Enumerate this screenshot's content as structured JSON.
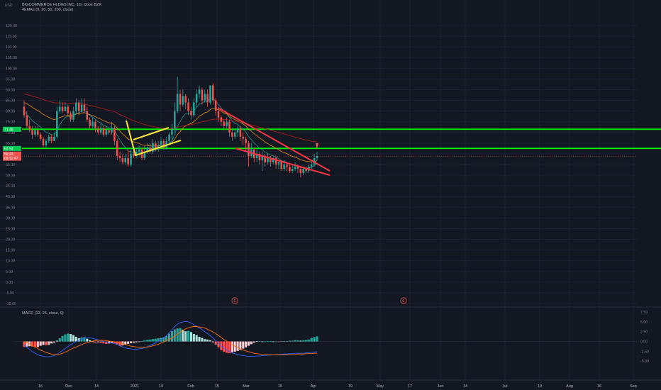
{
  "main": {
    "symbol_line": "BIGCOMMERCE HLDGS INC, 1D, Cboe BZX",
    "indicator_label": "4EMAs (9, 20, 50, 200, close)",
    "currency_label": "USD",
    "y_ticks": [
      "120.00",
      "115.00",
      "110.00",
      "105.00",
      "100.00",
      "95.00",
      "90.00",
      "85.00",
      "80.00",
      "75.00",
      "70.00",
      "65.00",
      "60.00",
      "55.00",
      "50.00",
      "45.00",
      "40.00",
      "35.00",
      "30.00",
      "25.00",
      "20.00",
      "15.00",
      "10.00",
      "5.00",
      "0.00",
      "-5.00",
      "-10.00"
    ],
    "price_badges": [
      {
        "text": "71.48",
        "color": "#00c853"
      },
      {
        "text": "62.53",
        "color": "#00c853"
      },
      {
        "text": "58.93",
        "color": "#ef5350"
      },
      {
        "text": "09:12:47",
        "color": "#ef5350"
      }
    ],
    "earnings_marker": "E"
  },
  "macd": {
    "label": "MACD (12, 26, close, 9)",
    "y_ticks": [
      "7.50",
      "5.00",
      "2.50",
      "0.00",
      "-2.50",
      "-5.00"
    ]
  },
  "time_axis": {
    "labels": [
      "16",
      "Dec",
      "14",
      "2021",
      "14",
      "Feb",
      "15",
      "Mar",
      "15",
      "Apr",
      "19",
      "May",
      "17",
      "Jun",
      "14",
      "Jul",
      "19",
      "Aug",
      "16",
      "Sep"
    ]
  },
  "colors": {
    "background": "#131722",
    "up": "#26a69a",
    "down": "#ef5350",
    "hline": "#00e600",
    "flag": "#ffeb3b",
    "wedge": "#f23645",
    "macd_line": "#2962ff",
    "signal_line": "#ff6d00"
  },
  "chart_data": {
    "type": "candlestick",
    "title": "BIGCOMMERCE HLDGS INC, 1D, Cboe BZX",
    "ylim": [
      -10,
      120
    ],
    "horizontal_levels": [
      71.48,
      62.53
    ],
    "candles": [
      [
        82,
        78,
        85,
        77
      ],
      [
        78,
        73,
        80,
        72
      ],
      [
        73,
        71,
        76,
        70
      ],
      [
        71,
        69,
        73,
        67
      ],
      [
        69,
        71,
        73,
        68
      ],
      [
        71,
        69,
        73,
        68
      ],
      [
        69,
        67,
        70,
        66
      ],
      [
        67,
        64,
        68,
        63
      ],
      [
        64,
        66,
        67,
        63
      ],
      [
        66,
        68,
        69,
        65
      ],
      [
        68,
        66,
        69,
        65
      ],
      [
        66,
        68,
        70,
        66
      ],
      [
        68,
        80,
        82,
        67
      ],
      [
        80,
        82,
        85,
        79
      ],
      [
        82,
        80,
        84,
        79
      ],
      [
        80,
        82,
        84,
        80
      ],
      [
        82,
        79,
        83,
        78
      ],
      [
        79,
        76,
        80,
        75
      ],
      [
        76,
        80,
        82,
        75
      ],
      [
        80,
        84,
        86,
        79
      ],
      [
        84,
        80,
        85,
        78
      ],
      [
        80,
        83,
        86,
        79
      ],
      [
        83,
        80,
        86,
        79
      ],
      [
        80,
        76,
        82,
        75
      ],
      [
        76,
        73,
        77,
        72
      ],
      [
        73,
        75,
        77,
        72
      ],
      [
        75,
        72,
        76,
        70
      ],
      [
        72,
        70,
        73,
        69
      ],
      [
        70,
        72,
        74,
        69
      ],
      [
        72,
        69,
        73,
        68
      ],
      [
        69,
        71,
        73,
        68
      ],
      [
        71,
        70,
        72,
        69
      ],
      [
        70,
        72,
        75,
        69
      ],
      [
        72,
        66,
        73,
        64
      ],
      [
        66,
        59,
        67,
        57
      ],
      [
        59,
        58,
        61,
        56
      ],
      [
        58,
        56,
        60,
        55
      ],
      [
        56,
        58,
        60,
        55
      ],
      [
        58,
        55,
        62,
        54
      ],
      [
        55,
        60,
        62,
        54
      ],
      [
        60,
        59,
        62,
        58
      ],
      [
        59,
        61,
        63,
        58
      ],
      [
        61,
        62,
        64,
        60
      ],
      [
        62,
        58,
        63,
        57
      ],
      [
        58,
        61,
        64,
        57
      ],
      [
        61,
        63,
        65,
        60
      ],
      [
        63,
        61,
        65,
        60
      ],
      [
        61,
        65,
        67,
        60
      ],
      [
        65,
        62,
        66,
        61
      ],
      [
        62,
        64,
        66,
        61
      ],
      [
        64,
        66,
        68,
        63
      ],
      [
        66,
        63,
        67,
        62
      ],
      [
        63,
        66,
        68,
        62
      ],
      [
        66,
        69,
        70,
        65
      ],
      [
        69,
        72,
        74,
        67
      ],
      [
        72,
        80,
        84,
        70
      ],
      [
        80,
        88,
        96,
        79
      ],
      [
        88,
        83,
        90,
        80
      ],
      [
        83,
        87,
        90,
        82
      ],
      [
        87,
        84,
        88,
        81
      ],
      [
        84,
        80,
        86,
        78
      ],
      [
        80,
        78,
        82,
        76
      ],
      [
        78,
        84,
        86,
        77
      ],
      [
        84,
        88,
        90,
        82
      ],
      [
        88,
        90,
        92,
        86
      ],
      [
        90,
        85,
        91,
        83
      ],
      [
        85,
        88,
        90,
        84
      ],
      [
        88,
        84,
        90,
        82
      ],
      [
        84,
        92,
        92,
        83
      ],
      [
        92,
        85,
        93,
        83
      ],
      [
        85,
        80,
        86,
        78
      ],
      [
        80,
        77,
        82,
        75
      ],
      [
        77,
        75,
        78,
        73
      ],
      [
        75,
        73,
        76,
        71
      ],
      [
        73,
        75,
        77,
        72
      ],
      [
        75,
        70,
        76,
        68
      ],
      [
        70,
        68,
        72,
        66
      ],
      [
        68,
        70,
        72,
        67
      ],
      [
        70,
        72,
        73,
        68
      ],
      [
        72,
        68,
        73,
        66
      ],
      [
        68,
        67,
        70,
        64
      ],
      [
        67,
        65,
        68,
        61
      ],
      [
        65,
        59,
        66,
        54
      ],
      [
        59,
        62,
        65,
        58
      ],
      [
        62,
        58,
        63,
        56
      ],
      [
        58,
        60,
        62,
        56
      ],
      [
        60,
        57,
        61,
        55
      ],
      [
        57,
        59,
        61,
        52
      ],
      [
        59,
        56,
        60,
        54
      ],
      [
        56,
        58,
        60,
        55
      ],
      [
        58,
        56,
        59,
        54
      ],
      [
        56,
        58,
        59,
        55
      ],
      [
        58,
        55,
        59,
        53
      ],
      [
        55,
        56,
        57,
        53
      ],
      [
        56,
        53,
        57,
        52
      ],
      [
        53,
        55,
        57,
        52
      ],
      [
        55,
        54,
        56,
        52
      ],
      [
        54,
        52,
        55,
        51
      ],
      [
        52,
        53,
        55,
        51
      ],
      [
        53,
        54,
        56,
        52
      ],
      [
        54,
        53,
        55,
        51
      ],
      [
        53,
        51,
        54,
        49
      ],
      [
        51,
        53,
        54,
        50
      ],
      [
        53,
        52,
        54,
        51
      ],
      [
        52,
        54,
        55,
        51
      ],
      [
        54,
        55,
        56,
        53
      ],
      [
        55,
        58,
        60,
        54
      ],
      [
        58,
        59,
        61,
        57
      ]
    ],
    "macd_hist": [
      -1.4,
      -1.3,
      -1.2,
      -1.3,
      -1.5,
      -1.4,
      -1.1,
      -0.9,
      -1.0,
      -0.8,
      -0.5,
      -0.3,
      0.2,
      0.8,
      1.4,
      1.8,
      2.0,
      1.9,
      1.6,
      1.2,
      0.8,
      1.0,
      1.1,
      0.7,
      0.3,
      -0.1,
      -0.3,
      -0.2,
      -0.4,
      -0.5,
      -0.6,
      -0.5,
      -0.4,
      -0.5,
      -0.8,
      -1.2,
      -1.0,
      -0.8,
      -0.6,
      -0.4,
      -0.3,
      -0.2,
      -0.1,
      0.1,
      0.3,
      0.4,
      0.5,
      0.6,
      0.7,
      0.8,
      0.9,
      1.1,
      1.4,
      2.0,
      2.6,
      3.1,
      3.3,
      3.4,
      3.0,
      2.6,
      2.7,
      2.4,
      1.9,
      1.6,
      1.2,
      0.9,
      0.6,
      0.5,
      0.3,
      -0.2,
      -0.8,
      -1.5,
      -2.2,
      -2.6,
      -2.9,
      -3.0,
      -2.8,
      -2.6,
      -2.4,
      -2.2,
      -1.8,
      -1.5,
      -1.1,
      -0.7,
      -0.3,
      0.1,
      0.1,
      0.0,
      0.0,
      0.1,
      0.1,
      0.0,
      0.0,
      -0.1,
      0.1,
      0.1,
      0.1,
      0.2,
      0.2,
      0.3,
      0.3,
      0.2,
      0.3,
      0.4,
      0.5,
      0.9,
      1.1,
      1.3
    ],
    "macd_line": [
      -1.0,
      -1.5,
      -2.0,
      -2.6,
      -3.0,
      -3.4,
      -3.6,
      -3.8,
      -3.9,
      -3.9,
      -3.8,
      -3.6,
      -3.3,
      -2.8,
      -2.3,
      -1.8,
      -1.3,
      -0.8,
      -0.4,
      0.0,
      0.3,
      0.6,
      0.8,
      0.9,
      0.9,
      0.8,
      0.6,
      0.4,
      0.2,
      0.0,
      -0.2,
      -0.3,
      -0.4,
      -0.5,
      -0.7,
      -1.1,
      -1.4,
      -1.6,
      -1.8,
      -1.9,
      -2.0,
      -2.0,
      -1.9,
      -1.8,
      -1.6,
      -1.3,
      -1.0,
      -0.7,
      -0.3,
      0.1,
      0.5,
      1.0,
      1.5,
      2.2,
      3.0,
      3.8,
      4.4,
      4.8,
      5.0,
      5.1,
      5.0,
      4.7,
      4.3,
      3.9,
      3.5,
      3.0,
      2.5,
      2.0,
      1.5,
      0.9,
      0.2,
      -0.5,
      -1.2,
      -1.8,
      -2.2,
      -2.6,
      -2.9,
      -3.1,
      -3.3,
      -3.5,
      -3.6,
      -3.7,
      -3.8,
      -3.8,
      -3.8,
      -3.7,
      -3.7,
      -3.6,
      -3.6,
      -3.5,
      -3.5,
      -3.4,
      -3.4,
      -3.3,
      -3.3,
      -3.2,
      -3.2,
      -3.1,
      -3.1,
      -3.0,
      -3.0,
      -3.0,
      -3.0,
      -2.9,
      -2.9,
      -2.8,
      -2.7,
      -2.6
    ],
    "signal_line": [
      0.0,
      -0.3,
      -0.6,
      -1.0,
      -1.4,
      -1.8,
      -2.2,
      -2.5,
      -2.8,
      -3.0,
      -3.2,
      -3.3,
      -3.3,
      -3.2,
      -3.0,
      -2.7,
      -2.4,
      -2.0,
      -1.7,
      -1.4,
      -1.1,
      -0.8,
      -0.5,
      -0.3,
      -0.1,
      0.1,
      0.2,
      0.3,
      0.3,
      0.3,
      0.2,
      0.1,
      0.0,
      -0.1,
      -0.2,
      -0.4,
      -0.6,
      -0.8,
      -1.0,
      -1.2,
      -1.3,
      -1.4,
      -1.5,
      -1.5,
      -1.5,
      -1.4,
      -1.3,
      -1.1,
      -0.9,
      -0.7,
      -0.4,
      -0.1,
      0.2,
      0.5,
      0.9,
      1.4,
      1.9,
      2.4,
      2.8,
      3.2,
      3.5,
      3.7,
      3.8,
      3.8,
      3.7,
      3.6,
      3.4,
      3.1,
      2.8,
      2.4,
      2.0,
      1.5,
      1.0,
      0.5,
      0.1,
      -0.4,
      -0.8,
      -1.2,
      -1.6,
      -1.9,
      -2.2,
      -2.4,
      -2.6,
      -2.8,
      -3.0,
      -3.1,
      -3.2,
      -3.3,
      -3.3,
      -3.4,
      -3.4,
      -3.4,
      -3.4,
      -3.4,
      -3.4,
      -3.4,
      -3.4,
      -3.3,
      -3.3,
      -3.3,
      -3.2,
      -3.2,
      -3.2,
      -3.1,
      -3.1,
      -3.1,
      -3.0,
      -3.0
    ],
    "ema9": [
      80,
      78.5,
      77,
      75.5,
      74.5,
      73.6,
      72.5,
      71.2,
      70.2,
      69.6,
      69,
      68.8,
      71,
      73.5,
      75.5,
      77,
      77.6,
      77.3,
      77.8,
      79,
      79.2,
      80,
      80,
      79.2,
      77.8,
      77.2,
      76.2,
      75,
      74.4,
      73.3,
      72.8,
      72.2,
      72.2,
      71,
      68.6,
      66.5,
      64.4,
      63,
      61.4,
      61,
      60.6,
      60.7,
      61,
      60.4,
      60.5,
      61,
      61,
      61.8,
      61.8,
      62.3,
      63,
      63,
      63.6,
      64.7,
      66.2,
      69,
      73,
      75,
      77.4,
      78.7,
      79,
      79,
      80.1,
      81.7,
      83.4,
      83.7,
      84.6,
      84.5,
      86,
      85.8,
      84.6,
      83,
      81.4,
      79.7,
      78.8,
      77,
      75.3,
      74.2,
      73.8,
      72.6,
      71.5,
      70.2,
      67.9,
      66.7,
      65,
      64,
      62.6,
      61.9,
      60.7,
      60.2,
      59.4,
      59.1,
      58.3,
      57.8,
      56.8,
      56.5,
      56,
      55.2,
      54.8,
      54.6,
      54.3,
      53.6,
      53.5,
      53.2,
      53.4,
      53.7,
      54.5,
      55.4
    ],
    "ema20": [
      84,
      83.4,
      82.6,
      81.7,
      80.9,
      80.2,
      79.4,
      78.4,
      77.7,
      77.1,
      76.4,
      76,
      76.4,
      77,
      77.4,
      77.8,
      77.9,
      77.8,
      78,
      78.6,
      78.7,
      79.1,
      79.2,
      78.9,
      78.3,
      78,
      77.4,
      76.7,
      76.2,
      75.5,
      75,
      74.5,
      74.3,
      73.5,
      72,
      70.6,
      69.2,
      68.2,
      66.9,
      66.3,
      65.6,
      65.2,
      64.9,
      64.2,
      64,
      63.9,
      63.7,
      63.8,
      63.6,
      63.7,
      63.9,
      63.8,
      64.1,
      64.6,
      65.3,
      66.8,
      69,
      70.4,
      72.1,
      73.1,
      73.8,
      74.2,
      75.1,
      76.3,
      77.6,
      78.3,
      79.2,
      79.6,
      80.8,
      81.2,
      81.1,
      80.6,
      79.9,
      79,
      78.6,
      77.7,
      76.7,
      76,
      75.5,
      74.7,
      73.9,
      73,
      71.5,
      70.6,
      69.4,
      68.5,
      67.4,
      66.6,
      65.5,
      64.8,
      63.9,
      63.4,
      62.6,
      61.9,
      61.1,
      60.6,
      60.1,
      59.3,
      58.8,
      58.4,
      57.9,
      57.2,
      56.9,
      56.5,
      56.4,
      56.2,
      56.4,
      56.8
    ],
    "ema50": [
      88,
      87.7,
      87.4,
      87,
      86.6,
      86.3,
      85.9,
      85.4,
      84.9,
      84.6,
      84.2,
      83.9,
      83.8,
      83.8,
      83.8,
      83.8,
      83.7,
      83.6,
      83.5,
      83.5,
      83.3,
      83.3,
      83.2,
      82.9,
      82.6,
      82.4,
      82.1,
      81.7,
      81.4,
      81.1,
      80.7,
      80.4,
      80.2,
      79.7,
      79.1,
      78.4,
      77.8,
      77.2,
      76.6,
      76,
      75.5,
      75,
      74.6,
      74.1,
      73.7,
      73.4,
      73,
      72.8,
      72.5,
      72.3,
      72,
      71.9,
      71.6,
      71.7,
      71.7,
      72,
      72.4,
      72.7,
      73.1,
      73.3,
      73.5,
      73.7,
      73.9,
      74.3,
      74.7,
      75,
      75.3,
      75.5,
      75.9,
      76.1,
      76.2,
      76.3,
      76.2,
      76.1,
      76,
      75.8,
      75.5,
      75.3,
      75.1,
      74.9,
      74.6,
      74.3,
      73.8,
      73.5,
      73.1,
      72.8,
      72.4,
      72.1,
      71.7,
      71.4,
      71,
      70.7,
      70.3,
      70,
      69.6,
      69.3,
      68.9,
      68.5,
      68.2,
      67.8,
      67.4,
      67.1,
      66.7,
      66.4,
      66.2,
      65.9,
      65.7,
      65.6
    ]
  }
}
